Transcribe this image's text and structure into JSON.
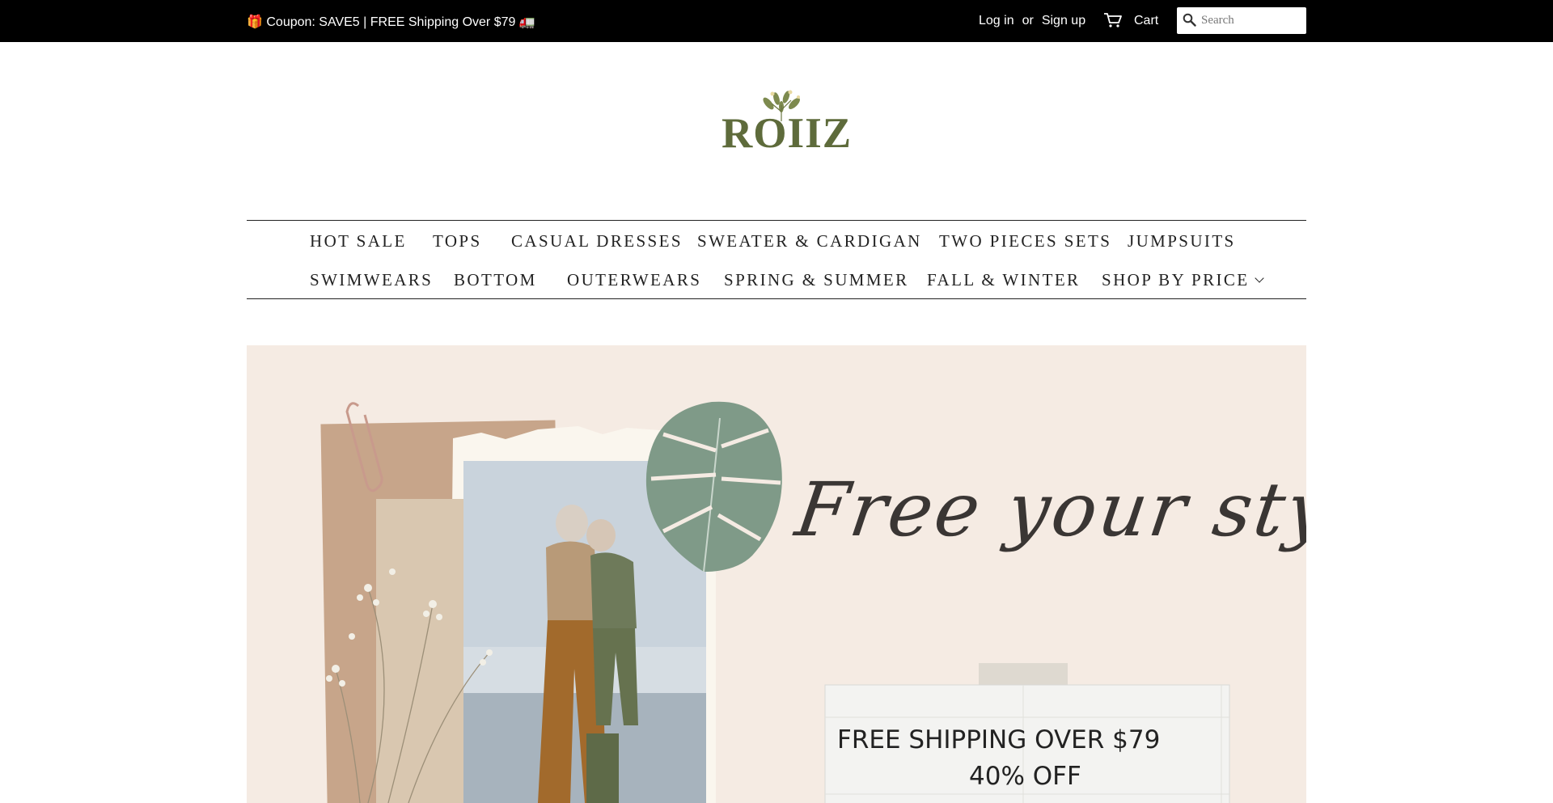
{
  "topbar": {
    "coupon_text": "🎁 Coupon: SAVE5 | FREE Shipping Over $79 🚛",
    "login_label": "Log in",
    "or_label": "or",
    "signup_label": "Sign up",
    "cart_label": "Cart",
    "search_placeholder": "Search"
  },
  "logo": {
    "text": "ROIIZ",
    "icon": "leaf-sprig-icon",
    "color": "#5e6b3b"
  },
  "nav": {
    "row1": [
      {
        "label": "HOT SALE"
      },
      {
        "label": "TOPS"
      },
      {
        "label": "CASUAL DRESSES"
      },
      {
        "label": "SWEATER & CARDIGAN"
      },
      {
        "label": "TWO PIECES SETS"
      },
      {
        "label": "JUMPSUITS"
      }
    ],
    "row2": [
      {
        "label": "SWIMWEARS"
      },
      {
        "label": "BOTTOM"
      },
      {
        "label": "OUTERWEARS"
      },
      {
        "label": "SPRING & SUMMER"
      },
      {
        "label": "FALL & WINTER"
      },
      {
        "label": "SHOP BY PRICE",
        "icon": "chevron-down-icon"
      }
    ]
  },
  "hero": {
    "script_text": "Free your style",
    "line1": "FREE SHIPPING OVER $79",
    "line2": "40% OFF",
    "background_color": "#f5ebe3"
  }
}
